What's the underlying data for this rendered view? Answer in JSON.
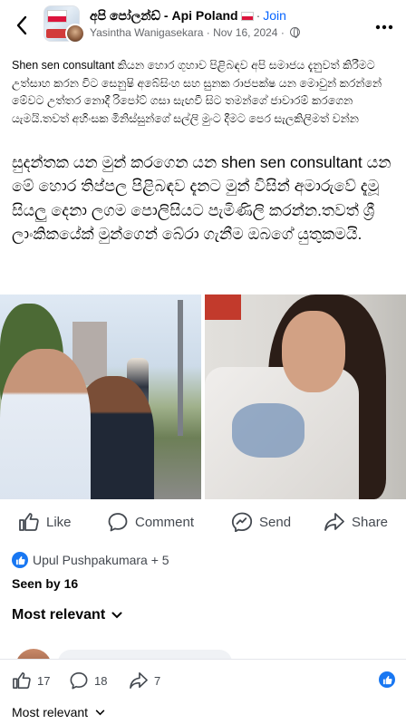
{
  "header": {
    "group_name": "අපි පෝලන්ඩ් - Api Poland",
    "join_label": "Join",
    "author": "Yasintha Wanigasekara",
    "date": "Nov 16, 2024",
    "separator": "·",
    "icons": {
      "back": "back-chevron-icon",
      "privacy": "globe-icon",
      "more": "more-options-icon"
    }
  },
  "post": {
    "caption": "Shen sen consultant කියන හොර ගුහාව පිළිබඳව අපි සමාජය දැනුවත් කිරීමට උත්සාහ කරන විට සෙනුෂි අබේසිංහ සහ සුනක රාජපක්ෂ යන මොවුන් කරන්නේ මේවට උත්තර නොදී රිපෝට් ගසා සැඟවී සිට තමන්ගේ ජාවාරම් කරගෙන යැමයි.තවත් අහිංසක මිනිස්සුන්ගේ සල්ලි මුංට දීමට පෙර සැලකිලිමත් වන්න",
    "highlight": "සුදන්තක යන මුන් කරගෙන යන shen sen consultant  යන මේ හොර තිප්පල පිළිබඳව දැනට මුන් විසින් අමාරුවේ දැමූ සියලු දෙනා ලගම පොලිසියට පැමිණිලි කරන්න.තවත් ශ්‍රී ලාංකිකයේක් මුන්ගෙන් බේරා ගැනීම ඔබගේ යුතුකමයි."
  },
  "actions": {
    "like": "Like",
    "comment": "Comment",
    "send": "Send",
    "share": "Share"
  },
  "reactions": {
    "names": "Upul Pushpakumara + 5",
    "seen_by": "Seen by 16"
  },
  "sort": {
    "label": "Most relevant"
  },
  "bottom_bar": {
    "likes": "17",
    "comments": "18",
    "shares": "7",
    "sort_label": "Most relevant"
  },
  "colors": {
    "accent": "#0866ff",
    "like_badge": "#1877f2",
    "muted_text": "#65676b"
  }
}
